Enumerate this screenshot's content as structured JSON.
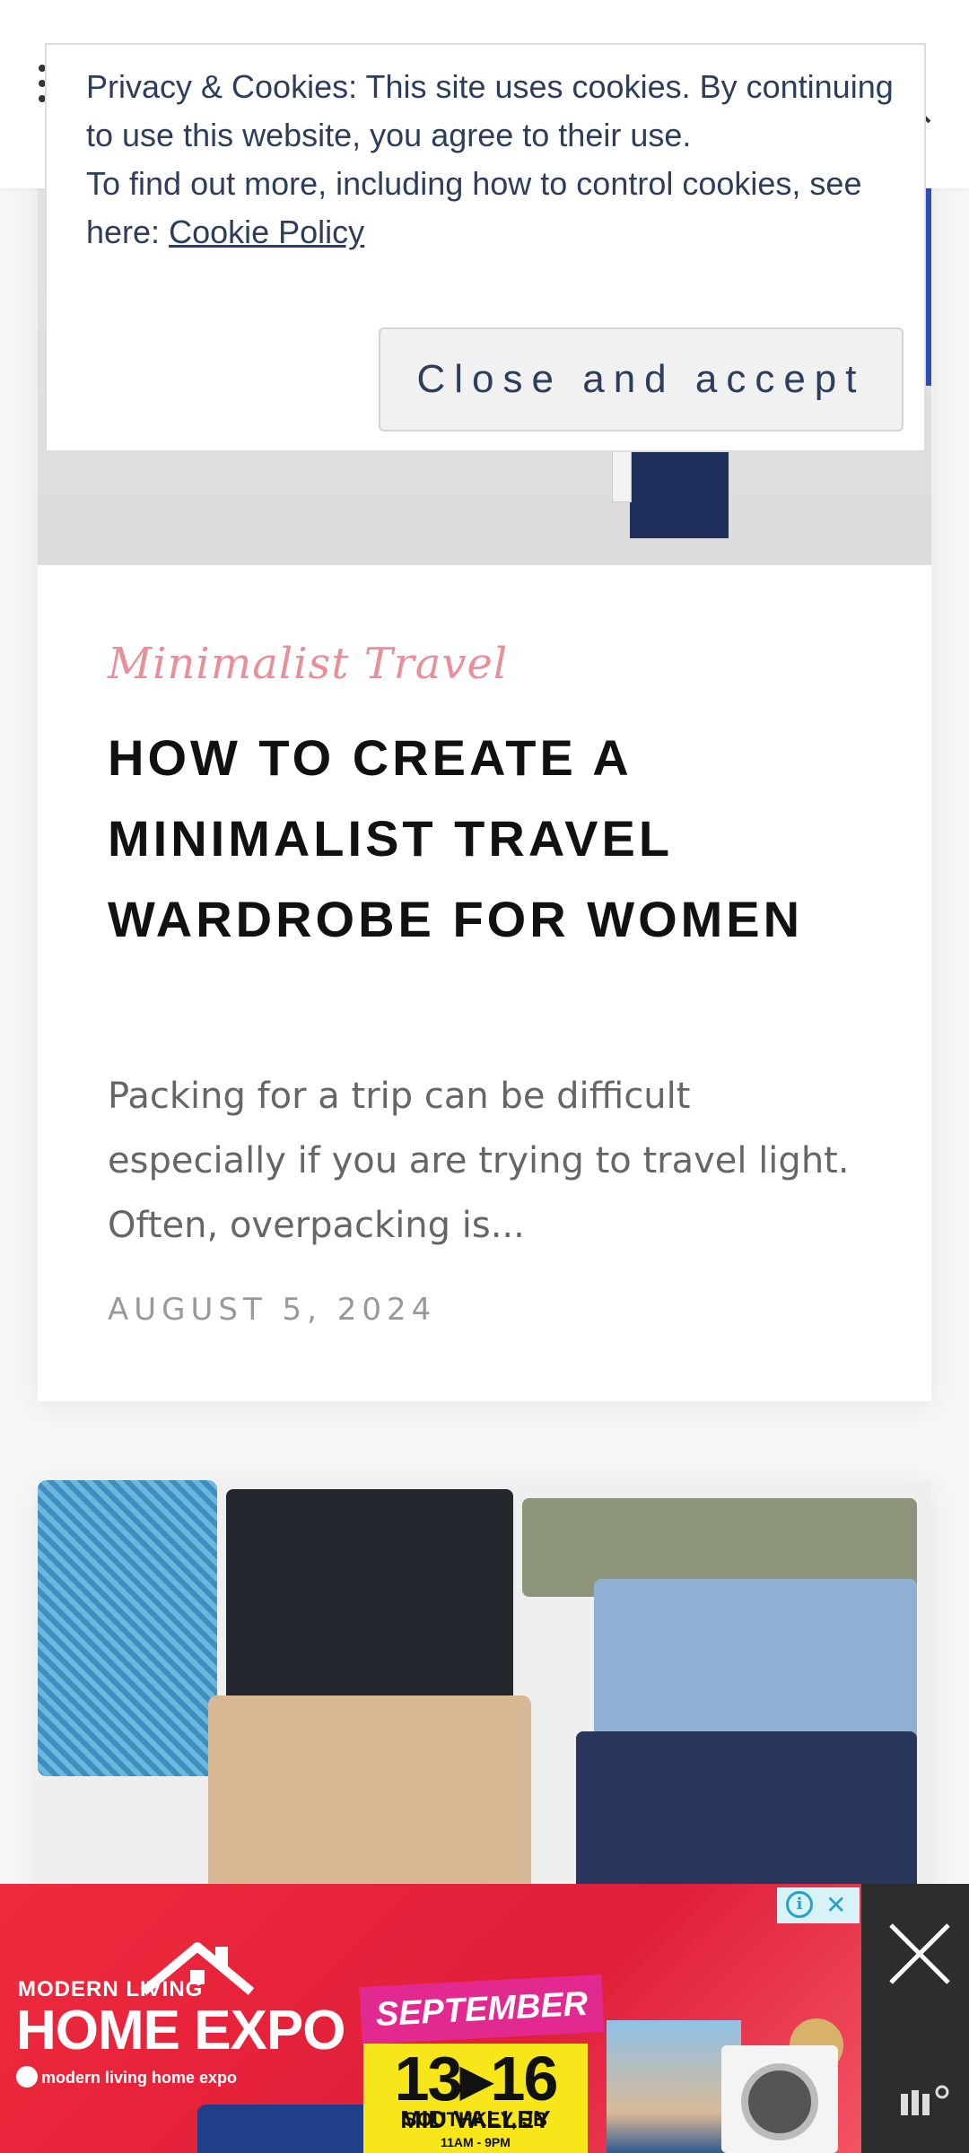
{
  "cookie_notice": {
    "line1": "Privacy & Cookies: This site uses cookies. By continuing to use this website, you agree to their use.",
    "line2_prefix": "To find out more, including how to control cookies, see here:",
    "link": "Cookie Policy",
    "button": "Close and accept"
  },
  "post": {
    "category": "Minimalist Travel",
    "title": "HOW TO CREATE A MINIMALIST TRAVEL WARDROBE FOR WOMEN",
    "excerpt": "Packing for a trip can be difficult especially if you are trying to travel light. Often, overpacking is...",
    "date": "AUGUST 5, 2024"
  },
  "ad": {
    "brand_small": "MODERN LIVING",
    "brand_large": "HOME EXPO",
    "social": "modern living home expo",
    "month": "SEPTEMBER",
    "dates": "13▸16",
    "venue": "MID VALLEY",
    "city": "SOUTHKEY, JB",
    "hours": "11AM - 9PM"
  },
  "colors": {
    "accent_pink": "#e88f9a",
    "cookie_text": "#2c3e5c",
    "ad_red": "#e01e3a",
    "ad_yellow": "#f7e61a"
  },
  "icons": [
    "menu-dots-icon",
    "search-icon",
    "info-icon",
    "close-icon",
    "ad-network-logo-icon"
  ]
}
